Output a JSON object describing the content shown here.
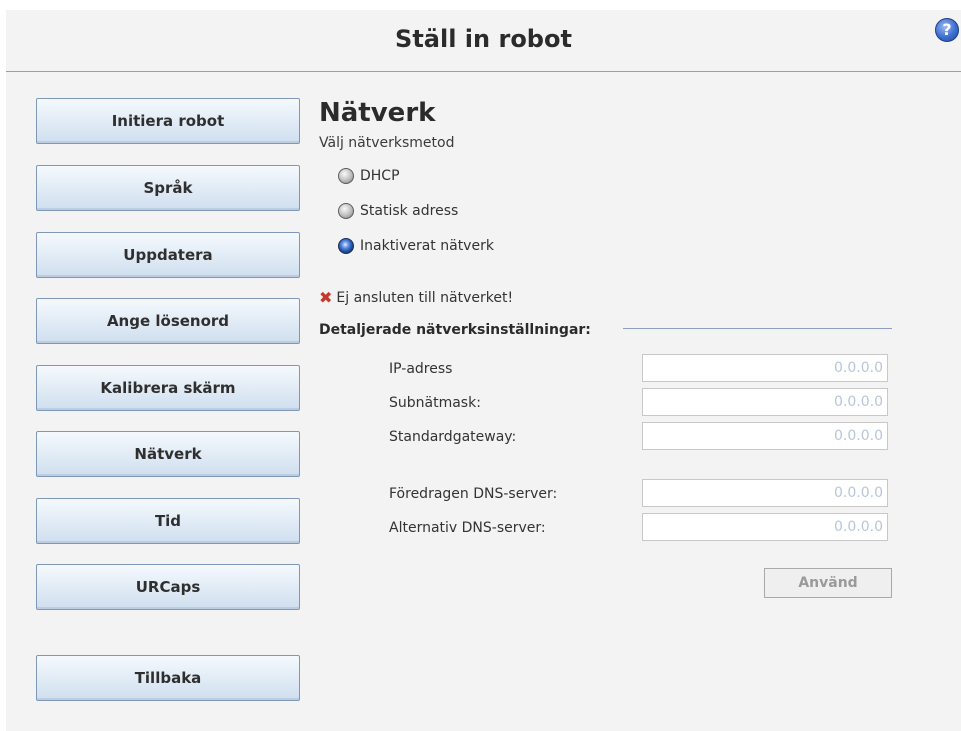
{
  "header": {
    "title": "Ställ in robot",
    "help_label": "?"
  },
  "nav": [
    {
      "label": "Initiera robot"
    },
    {
      "label": "Språk"
    },
    {
      "label": "Uppdatera"
    },
    {
      "label": "Ange lösenord"
    },
    {
      "label": "Kalibrera skärm"
    },
    {
      "label": "Nätverk"
    },
    {
      "label": "Tid"
    },
    {
      "label": "URCaps"
    },
    {
      "label": "Tillbaka"
    }
  ],
  "network": {
    "title": "Nätverk",
    "subtitle": "Välj nätverksmetod",
    "options": [
      {
        "label": "DHCP",
        "selected": false
      },
      {
        "label": "Statisk adress",
        "selected": false
      },
      {
        "label": "Inaktiverat nätverk",
        "selected": true
      }
    ],
    "status_icon": "✖",
    "status": "Ej ansluten till nätverket!",
    "details_title": "Detaljerade nätverksinställningar:",
    "fields": [
      {
        "label": "IP-adress",
        "value": "0.0.0.0"
      },
      {
        "label": "Subnätmask:",
        "value": "0.0.0.0"
      },
      {
        "label": "Standardgateway:",
        "value": "0.0.0.0"
      },
      {
        "label": "Föredragen DNS-server:",
        "value": "0.0.0.0"
      },
      {
        "label": "Alternativ DNS-server:",
        "value": "0.0.0.0"
      }
    ],
    "apply_label": "Använd"
  }
}
